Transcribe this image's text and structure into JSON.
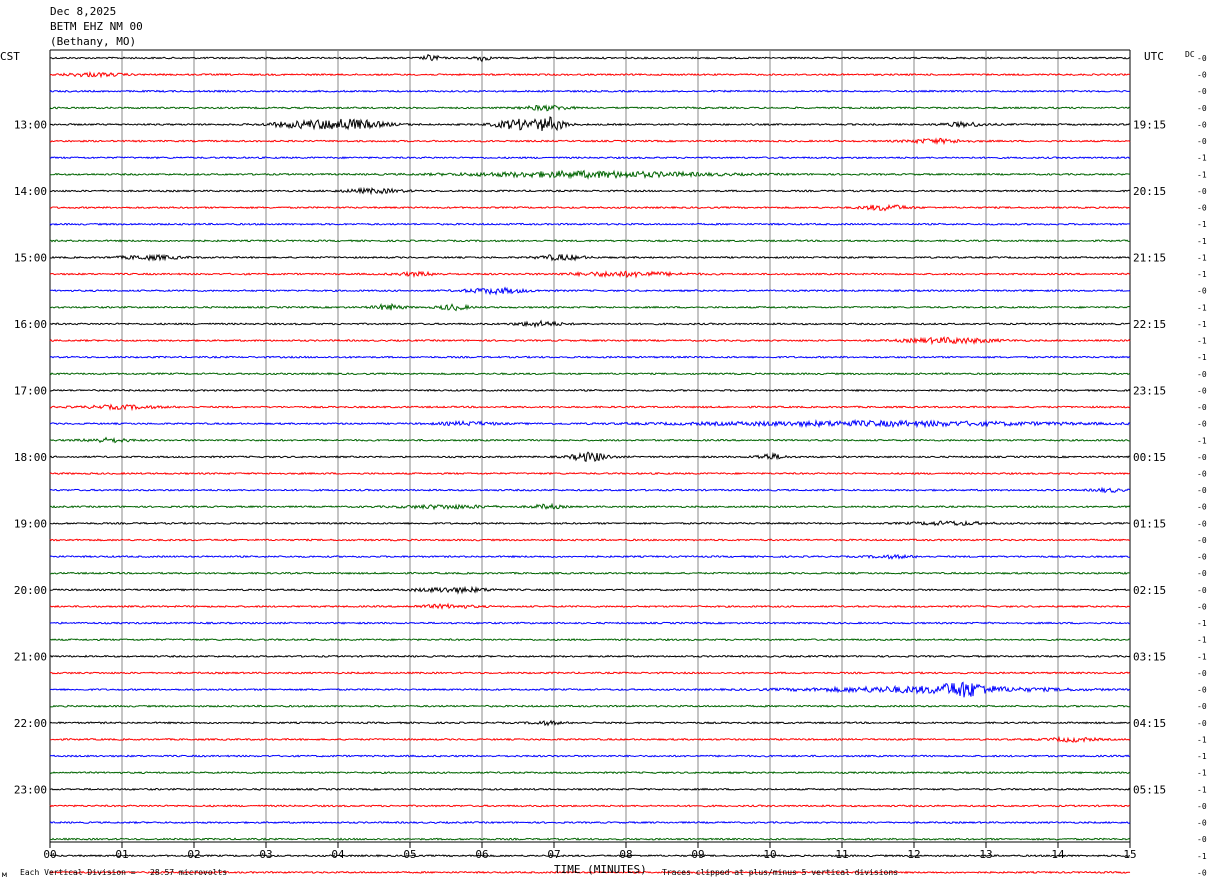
{
  "header": {
    "date": "Dec 8,2025",
    "station": "BETM EHZ NM 00",
    "location": "(Bethany, MO)"
  },
  "left_timezone": "CST",
  "right_timezone": "UTC",
  "dc_label": "DC",
  "footer": {
    "scale_note": "Each Vertical Division =   28.57 microvolts",
    "clip_note": "Traces clipped at plus/minus 5 vertical divisions",
    "mark": "м"
  },
  "chart_data": {
    "type": "line",
    "title": "",
    "xlabel": "TIME (MINUTES)",
    "ylabel": "",
    "xlim": [
      0,
      15
    ],
    "x_ticks": [
      "00",
      "01",
      "02",
      "03",
      "04",
      "05",
      "06",
      "07",
      "08",
      "09",
      "10",
      "11",
      "12",
      "13",
      "14",
      "15"
    ],
    "grid": true,
    "trace_colors": [
      "#000000",
      "#ff0000",
      "#0000ff",
      "#006400"
    ],
    "rows_per_hour": 4,
    "minutes_per_row": 15,
    "left_hour_labels": [
      "13:00",
      "14:00",
      "15:00",
      "16:00",
      "17:00",
      "18:00",
      "19:00",
      "20:00",
      "21:00",
      "22:00",
      "23:00"
    ],
    "right_hour_labels": [
      "19:15",
      "20:15",
      "21:15",
      "22:15",
      "23:15",
      "00:15",
      "01:15",
      "02:15",
      "03:15",
      "04:15",
      "05:15"
    ],
    "dc_offsets": [
      "-0",
      "-0",
      "-0",
      "-0",
      "-0",
      "-0",
      "-1",
      "-1",
      "-0",
      "-0",
      "-1",
      "-1",
      "-1",
      "-1",
      "-0",
      "-1",
      "-1",
      "-1",
      "-1",
      "-0",
      "-0",
      "-0",
      "-0",
      "-1",
      "-0",
      "-0",
      "-0",
      "-0",
      "-0",
      "-0",
      "-0",
      "-0",
      "-0",
      "-0",
      "-1",
      "-1",
      "-1",
      "-0",
      "-0",
      "-0",
      "-0",
      "-1",
      "-1",
      "-1",
      "-1",
      "-0",
      "-0",
      "-0",
      "-1",
      "-0",
      "-0",
      "-1"
    ],
    "events": [
      {
        "row": 0,
        "minute": 5.3,
        "amp": 1.0,
        "width": 0.1
      },
      {
        "row": 0,
        "minute": 6.0,
        "amp": 0.9,
        "width": 0.1
      },
      {
        "row": 1,
        "minute": 0.6,
        "amp": 0.5,
        "width": 0.4
      },
      {
        "row": 3,
        "minute": 6.9,
        "amp": 0.7,
        "width": 0.3
      },
      {
        "row": 4,
        "minute": 4.1,
        "amp": 1.6,
        "width": 0.5
      },
      {
        "row": 4,
        "minute": 3.4,
        "amp": 0.7,
        "width": 0.4
      },
      {
        "row": 4,
        "minute": 6.5,
        "amp": 1.5,
        "width": 0.3
      },
      {
        "row": 4,
        "minute": 6.95,
        "amp": 2.0,
        "width": 0.2
      },
      {
        "row": 4,
        "minute": 12.7,
        "amp": 0.6,
        "width": 0.3
      },
      {
        "row": 5,
        "minute": 12.3,
        "amp": 0.6,
        "width": 0.4
      },
      {
        "row": 7,
        "minute": 7.5,
        "amp": 0.9,
        "width": 1.6
      },
      {
        "row": 8,
        "minute": 4.5,
        "amp": 0.6,
        "width": 0.4
      },
      {
        "row": 9,
        "minute": 11.6,
        "amp": 0.8,
        "width": 0.3
      },
      {
        "row": 12,
        "minute": 1.4,
        "amp": 0.6,
        "width": 0.4
      },
      {
        "row": 12,
        "minute": 7.1,
        "amp": 0.8,
        "width": 0.3
      },
      {
        "row": 13,
        "minute": 8.0,
        "amp": 0.7,
        "width": 0.7
      },
      {
        "row": 13,
        "minute": 5.1,
        "amp": 0.5,
        "width": 0.3
      },
      {
        "row": 14,
        "minute": 6.2,
        "amp": 0.8,
        "width": 0.4
      },
      {
        "row": 15,
        "minute": 4.7,
        "amp": 0.8,
        "width": 0.2
      },
      {
        "row": 15,
        "minute": 5.6,
        "amp": 0.8,
        "width": 0.2
      },
      {
        "row": 16,
        "minute": 6.8,
        "amp": 0.7,
        "width": 0.3
      },
      {
        "row": 17,
        "minute": 12.5,
        "amp": 0.8,
        "width": 0.6
      },
      {
        "row": 21,
        "minute": 1.0,
        "amp": 0.5,
        "width": 0.5
      },
      {
        "row": 22,
        "minute": 11.5,
        "amp": 0.7,
        "width": 2.5
      },
      {
        "row": 22,
        "minute": 5.8,
        "amp": 0.5,
        "width": 0.4
      },
      {
        "row": 23,
        "minute": 0.8,
        "amp": 0.6,
        "width": 0.3
      },
      {
        "row": 24,
        "minute": 7.5,
        "amp": 1.3,
        "width": 0.25
      },
      {
        "row": 24,
        "minute": 10.0,
        "amp": 0.8,
        "width": 0.2
      },
      {
        "row": 26,
        "minute": 14.7,
        "amp": 0.5,
        "width": 0.2
      },
      {
        "row": 27,
        "minute": 5.5,
        "amp": 0.5,
        "width": 0.6
      },
      {
        "row": 27,
        "minute": 6.9,
        "amp": 0.6,
        "width": 0.2
      },
      {
        "row": 28,
        "minute": 12.5,
        "amp": 0.5,
        "width": 0.5
      },
      {
        "row": 30,
        "minute": 11.7,
        "amp": 0.4,
        "width": 0.3
      },
      {
        "row": 32,
        "minute": 5.6,
        "amp": 0.7,
        "width": 0.5
      },
      {
        "row": 33,
        "minute": 5.5,
        "amp": 0.5,
        "width": 0.4
      },
      {
        "row": 38,
        "minute": 12.2,
        "amp": 0.9,
        "width": 1.6
      },
      {
        "row": 38,
        "minute": 12.7,
        "amp": 1.7,
        "width": 0.3
      },
      {
        "row": 40,
        "minute": 6.9,
        "amp": 0.5,
        "width": 0.2
      },
      {
        "row": 41,
        "minute": 14.2,
        "amp": 0.6,
        "width": 0.3
      }
    ]
  }
}
